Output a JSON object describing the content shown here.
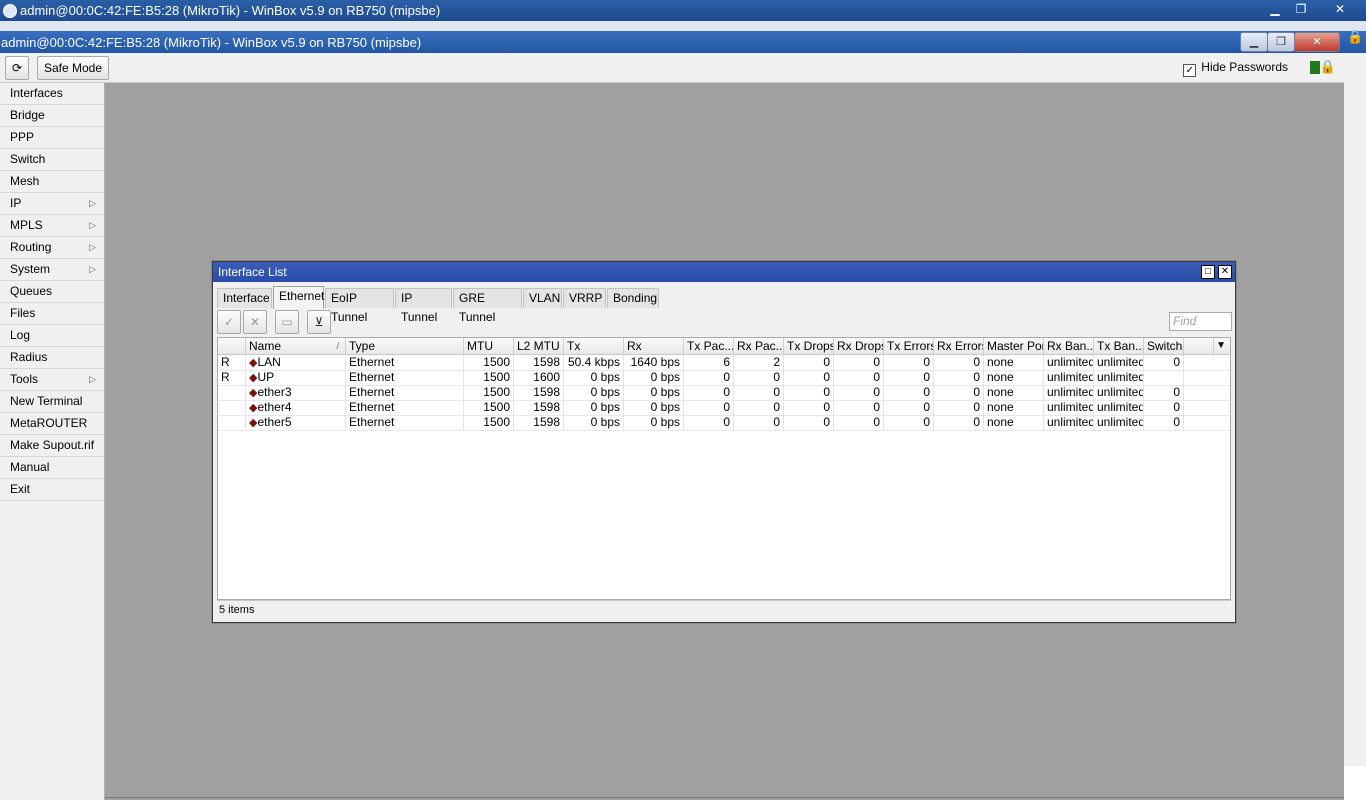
{
  "outer_window": {
    "title": "admin@00:0C:42:FE:B5:28 (MikroTik) - WinBox v5.9 on RB750 (mipsbe)",
    "minimize": "▁",
    "restore": "❐",
    "close": "✕"
  },
  "inner_window": {
    "title": "admin@00:0C:42:FE:B5:28 (MikroTik) - WinBox v5.9 on RB750 (mipsbe)",
    "minimize": "▁",
    "restore": "❐",
    "close": "✕"
  },
  "toolbar": {
    "refresh_icon": "⟳",
    "safe_mode_label": "Safe Mode",
    "hide_passwords_label": "Hide Passwords",
    "hide_passwords_checked": "✓",
    "lock_icon": "🔒"
  },
  "sidebar": {
    "items": [
      {
        "label": "Interfaces",
        "submenu": ""
      },
      {
        "label": "Bridge",
        "submenu": ""
      },
      {
        "label": "PPP",
        "submenu": ""
      },
      {
        "label": "Switch",
        "submenu": ""
      },
      {
        "label": "Mesh",
        "submenu": ""
      },
      {
        "label": "IP",
        "submenu": "▷"
      },
      {
        "label": "MPLS",
        "submenu": "▷"
      },
      {
        "label": "Routing",
        "submenu": "▷"
      },
      {
        "label": "System",
        "submenu": "▷"
      },
      {
        "label": "Queues",
        "submenu": ""
      },
      {
        "label": "Files",
        "submenu": ""
      },
      {
        "label": "Log",
        "submenu": ""
      },
      {
        "label": "Radius",
        "submenu": ""
      },
      {
        "label": "Tools",
        "submenu": "▷"
      },
      {
        "label": "New Terminal",
        "submenu": ""
      },
      {
        "label": "MetaROUTER",
        "submenu": ""
      },
      {
        "label": "Make Supout.rif",
        "submenu": ""
      },
      {
        "label": "Manual",
        "submenu": ""
      },
      {
        "label": "Exit",
        "submenu": ""
      }
    ]
  },
  "interface_list": {
    "title": "Interface List",
    "maximize": "□",
    "close": "✕",
    "tabs": [
      "Interface",
      "Ethernet",
      "EoIP Tunnel",
      "IP Tunnel",
      "GRE Tunnel",
      "VLAN",
      "VRRP",
      "Bonding"
    ],
    "active_tab": "Ethernet",
    "buttons": {
      "enable": "✓",
      "disable": "✕",
      "comment": "▭",
      "filter": "⊻"
    },
    "find_placeholder": "Find",
    "columns": [
      "",
      "Name",
      "Type",
      "MTU",
      "L2 MTU",
      "Tx",
      "Rx",
      "Tx Pac...",
      "Rx Pac...",
      "Tx Drops",
      "Rx Drops",
      "Tx Errors",
      "Rx Errors",
      "Master Port",
      "Rx Ban...",
      "Tx Ban...",
      "Switch"
    ],
    "sort_indicator": "/",
    "column_menu": "▼",
    "rows": [
      {
        "flag": "R",
        "name": "LAN",
        "type": "Ethernet",
        "mtu": "1500",
        "l2mtu": "1598",
        "tx": "50.4 kbps",
        "rx": "1640 bps",
        "txp": "6",
        "rxp": "2",
        "txd": "0",
        "rxd": "0",
        "txe": "0",
        "rxe": "0",
        "master": "none",
        "rxban": "unlimited",
        "txban": "unlimited",
        "switch": "0"
      },
      {
        "flag": "R",
        "name": "UP",
        "type": "Ethernet",
        "mtu": "1500",
        "l2mtu": "1600",
        "tx": "0 bps",
        "rx": "0 bps",
        "txp": "0",
        "rxp": "0",
        "txd": "0",
        "rxd": "0",
        "txe": "0",
        "rxe": "0",
        "master": "none",
        "rxban": "unlimited",
        "txban": "unlimited",
        "switch": ""
      },
      {
        "flag": "",
        "name": "ether3",
        "type": "Ethernet",
        "mtu": "1500",
        "l2mtu": "1598",
        "tx": "0 bps",
        "rx": "0 bps",
        "txp": "0",
        "rxp": "0",
        "txd": "0",
        "rxd": "0",
        "txe": "0",
        "rxe": "0",
        "master": "none",
        "rxban": "unlimited",
        "txban": "unlimited",
        "switch": "0"
      },
      {
        "flag": "",
        "name": "ether4",
        "type": "Ethernet",
        "mtu": "1500",
        "l2mtu": "1598",
        "tx": "0 bps",
        "rx": "0 bps",
        "txp": "0",
        "rxp": "0",
        "txd": "0",
        "rxd": "0",
        "txe": "0",
        "rxe": "0",
        "master": "none",
        "rxban": "unlimited",
        "txban": "unlimited",
        "switch": "0"
      },
      {
        "flag": "",
        "name": "ether5",
        "type": "Ethernet",
        "mtu": "1500",
        "l2mtu": "1598",
        "tx": "0 bps",
        "rx": "0 bps",
        "txp": "0",
        "rxp": "0",
        "txd": "0",
        "rxd": "0",
        "txe": "0",
        "rxe": "0",
        "master": "none",
        "rxban": "unlimited",
        "txban": "unlimited",
        "switch": "0"
      }
    ],
    "row_icon": "◆",
    "status": "5 items"
  }
}
